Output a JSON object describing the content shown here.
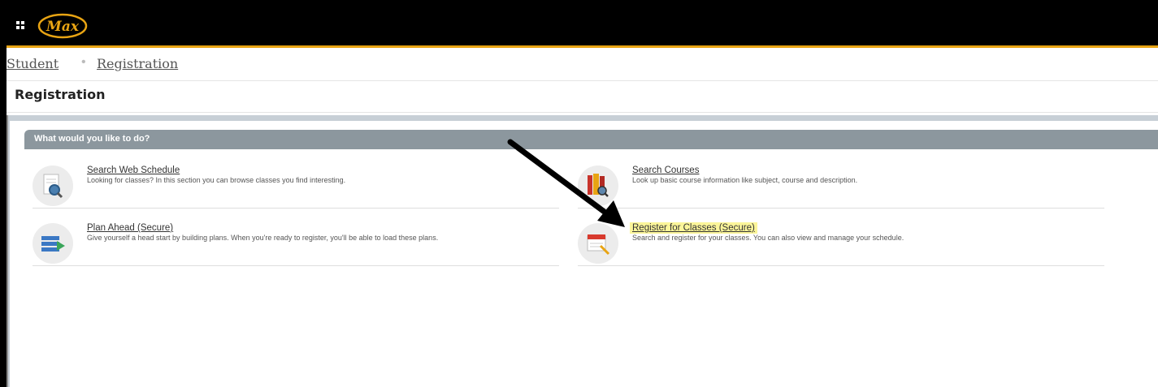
{
  "header": {
    "logo_text": "Max",
    "brand_color": "#e8a413"
  },
  "breadcrumb": {
    "items": [
      "Student",
      "Registration"
    ],
    "separator": "•"
  },
  "page": {
    "title": "Registration"
  },
  "panel": {
    "title": "What would you like to do?"
  },
  "actions": [
    {
      "label": "Search Web Schedule",
      "description": "Looking for classes? In this section you can browse classes you find interesting.",
      "icon": "magnifier-document-icon"
    },
    {
      "label": "Search Courses",
      "description": "Look up basic course information like subject, course and description.",
      "icon": "books-magnifier-icon"
    },
    {
      "label": "Plan Ahead (Secure)",
      "description": "Give yourself a head start by building plans. When you're ready to register, you'll be able to load these plans.",
      "icon": "plan-stack-icon"
    },
    {
      "label": "Register for Classes (Secure)",
      "description": "Search and register for your classes. You can also view and manage your schedule.",
      "icon": "calendar-pencil-icon",
      "highlighted": true
    }
  ]
}
